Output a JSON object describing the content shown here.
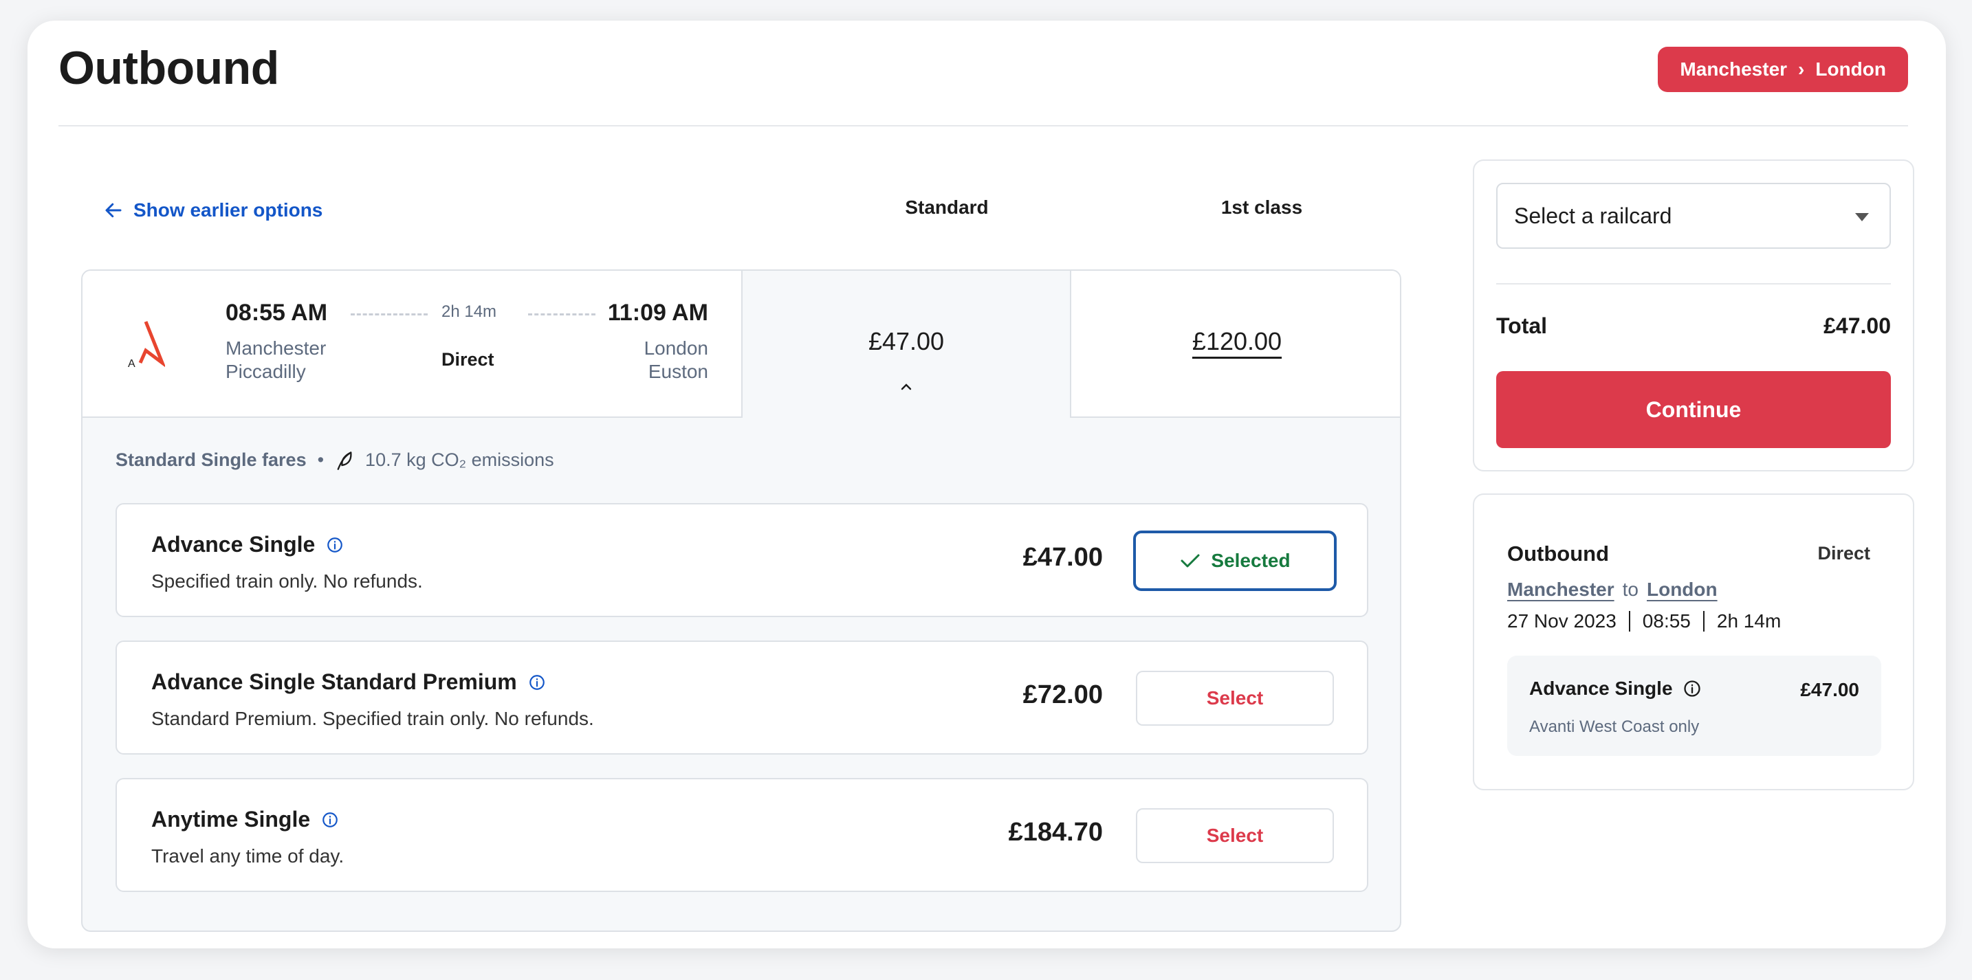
{
  "header": {
    "title": "Outbound",
    "route_from": "Manchester",
    "route_sep": "›",
    "route_to": "London"
  },
  "nav": {
    "earlier_label": "Show earlier options"
  },
  "columns": {
    "standard": "Standard",
    "first": "1st class"
  },
  "journey": {
    "departure_time": "08:55 AM",
    "departure_station_line1": "Manchester",
    "departure_station_line2": "Piccadilly",
    "duration": "2h 14m",
    "changes": "Direct",
    "arrival_time": "11:09 AM",
    "arrival_station_line1": "London",
    "arrival_station_line2": "Euston",
    "operator_logo_letter": "A",
    "standard_price": "£47.00",
    "first_price": "£120.00"
  },
  "fares": {
    "header_label": "Standard Single fares",
    "bullet": "•",
    "emissions": "10.7 kg CO₂ emissions",
    "items": [
      {
        "name": "Advance Single",
        "description": "Specified train only. No refunds.",
        "price": "£47.00",
        "action": "Selected",
        "selected": true
      },
      {
        "name": "Advance Single Standard Premium",
        "description": "Standard Premium. Specified train only. No refunds.",
        "price": "£72.00",
        "action": "Select",
        "selected": false
      },
      {
        "name": "Anytime Single",
        "description": "Travel any time of day.",
        "price": "£184.70",
        "action": "Select",
        "selected": false
      }
    ]
  },
  "basket": {
    "railcard_placeholder": "Select a railcard",
    "total_label": "Total",
    "total_value": "£47.00",
    "continue_label": "Continue"
  },
  "summary": {
    "title": "Outbound",
    "changes": "Direct",
    "from": "Manchester",
    "to_word": "to",
    "to": "London",
    "date": "27 Nov 2023",
    "time": "08:55",
    "duration": "2h 14m",
    "fare_name": "Advance Single",
    "fare_price": "£47.00",
    "fare_note": "Avanti West Coast only"
  },
  "colors": {
    "brand_red": "#dc3a4b",
    "link_blue": "#1356c8",
    "selected_border": "#1e5aa8",
    "selected_text": "#167a3e"
  }
}
